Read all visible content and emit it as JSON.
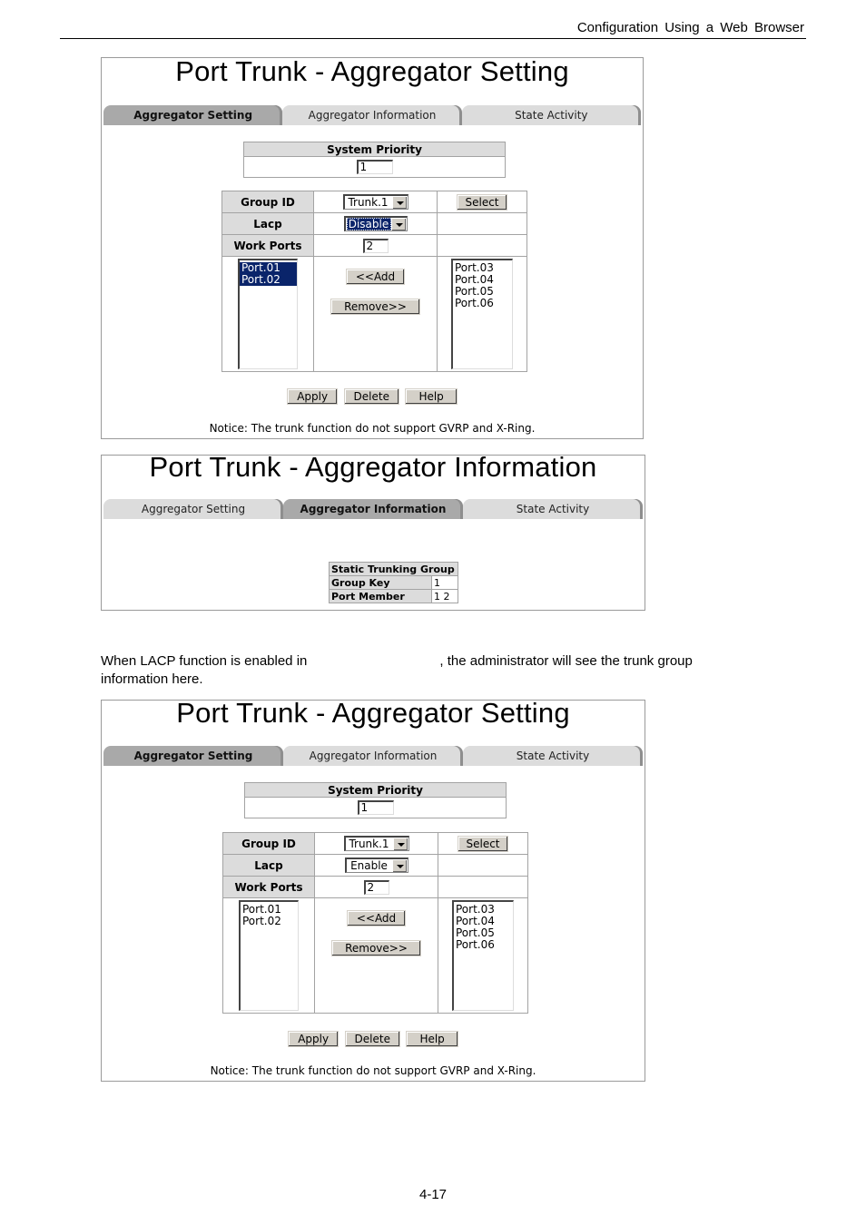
{
  "page": {
    "header": "Configuration Using a Web Browser",
    "page_number": "4-17",
    "body_text_before": "When LACP function is enabled in",
    "body_text_after": ", the administrator will see the trunk group information here."
  },
  "tabs": [
    "Aggregator Setting",
    "Aggregator Information",
    "State Activity"
  ],
  "setting_panel_1": {
    "title": "Port Trunk - Aggregator Setting",
    "active_tab": 0,
    "system_priority_label": "System Priority",
    "system_priority_value": "1",
    "group_id_label": "Group ID",
    "group_id_value": "Trunk.1",
    "select_button": "Select",
    "lacp_label": "Lacp",
    "lacp_value": "Disable",
    "work_ports_label": "Work Ports",
    "work_ports_value": "2",
    "member_ports": [
      "Port.01",
      "Port.02"
    ],
    "available_ports": [
      "Port.03",
      "Port.04",
      "Port.05",
      "Port.06"
    ],
    "add_button": "<<Add",
    "remove_button": "Remove>>",
    "apply_button": "Apply",
    "delete_button": "Delete",
    "help_button": "Help",
    "notice": "Notice: The trunk function do not support GVRP and X-Ring."
  },
  "info_panel": {
    "title": "Port Trunk - Aggregator Information",
    "active_tab": 1,
    "group_header": "Static Trunking Group",
    "group_key_label": "Group Key",
    "group_key_value": "1",
    "port_member_label": "Port Member",
    "port_member_value": "1 2"
  },
  "setting_panel_2": {
    "title": "Port Trunk - Aggregator Setting",
    "active_tab": 0,
    "system_priority_label": "System Priority",
    "system_priority_value": "1",
    "group_id_label": "Group ID",
    "group_id_value": "Trunk.1",
    "select_button": "Select",
    "lacp_label": "Lacp",
    "lacp_value": "Enable",
    "work_ports_label": "Work Ports",
    "work_ports_value": "2",
    "member_ports": [
      "Port.01",
      "Port.02"
    ],
    "available_ports": [
      "Port.03",
      "Port.04",
      "Port.05",
      "Port.06"
    ],
    "add_button": "<<Add",
    "remove_button": "Remove>>",
    "apply_button": "Apply",
    "delete_button": "Delete",
    "help_button": "Help",
    "notice": "Notice: The trunk function do not support GVRP and X-Ring."
  }
}
